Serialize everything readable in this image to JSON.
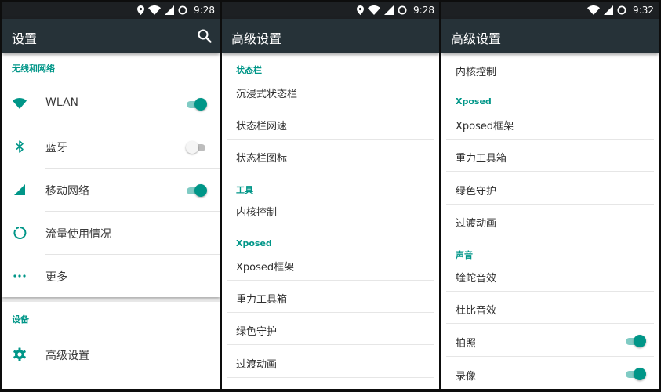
{
  "colors": {
    "accent": "#009688",
    "toolbar": "#263238",
    "statusbar": "#1d2023"
  },
  "panels": [
    {
      "time": "9:28",
      "title": "设置",
      "sections": [
        {
          "header": "无线和网络",
          "items": [
            {
              "label": "WLAN",
              "icon": "wifi-icon",
              "toggle": "on"
            },
            {
              "label": "蓝牙",
              "icon": "bluetooth-icon",
              "toggle": "off"
            },
            {
              "label": "移动网络",
              "icon": "signal-icon",
              "toggle": "on"
            },
            {
              "label": "流量使用情况",
              "icon": "data-usage-icon"
            },
            {
              "label": "更多",
              "icon": "more-icon"
            }
          ]
        },
        {
          "header": "设备",
          "items": [
            {
              "label": "高级设置",
              "icon": "gear-icon"
            }
          ]
        }
      ]
    },
    {
      "time": "9:28",
      "title": "高级设置",
      "sections": [
        {
          "header": "状态栏",
          "items": [
            {
              "label": "沉浸式状态栏"
            },
            {
              "label": "状态栏网速"
            },
            {
              "label": "状态栏图标"
            }
          ]
        },
        {
          "header": "工具",
          "items": [
            {
              "label": "内核控制"
            }
          ]
        },
        {
          "header": "Xposed",
          "items": [
            {
              "label": "Xposed框架"
            },
            {
              "label": "重力工具箱"
            },
            {
              "label": "绿色守护"
            },
            {
              "label": "过渡动画"
            }
          ]
        }
      ]
    },
    {
      "time": "9:32",
      "title": "高级设置",
      "sections": [
        {
          "header": "",
          "items": [
            {
              "label": "内核控制"
            }
          ]
        },
        {
          "header": "Xposed",
          "items": [
            {
              "label": "Xposed框架"
            },
            {
              "label": "重力工具箱"
            },
            {
              "label": "绿色守护"
            },
            {
              "label": "过渡动画"
            }
          ]
        },
        {
          "header": "声音",
          "items": [
            {
              "label": "蝰蛇音效"
            },
            {
              "label": "杜比音效"
            },
            {
              "label": "拍照",
              "toggle": "on"
            },
            {
              "label": "录像",
              "toggle": "on"
            }
          ]
        }
      ]
    }
  ]
}
